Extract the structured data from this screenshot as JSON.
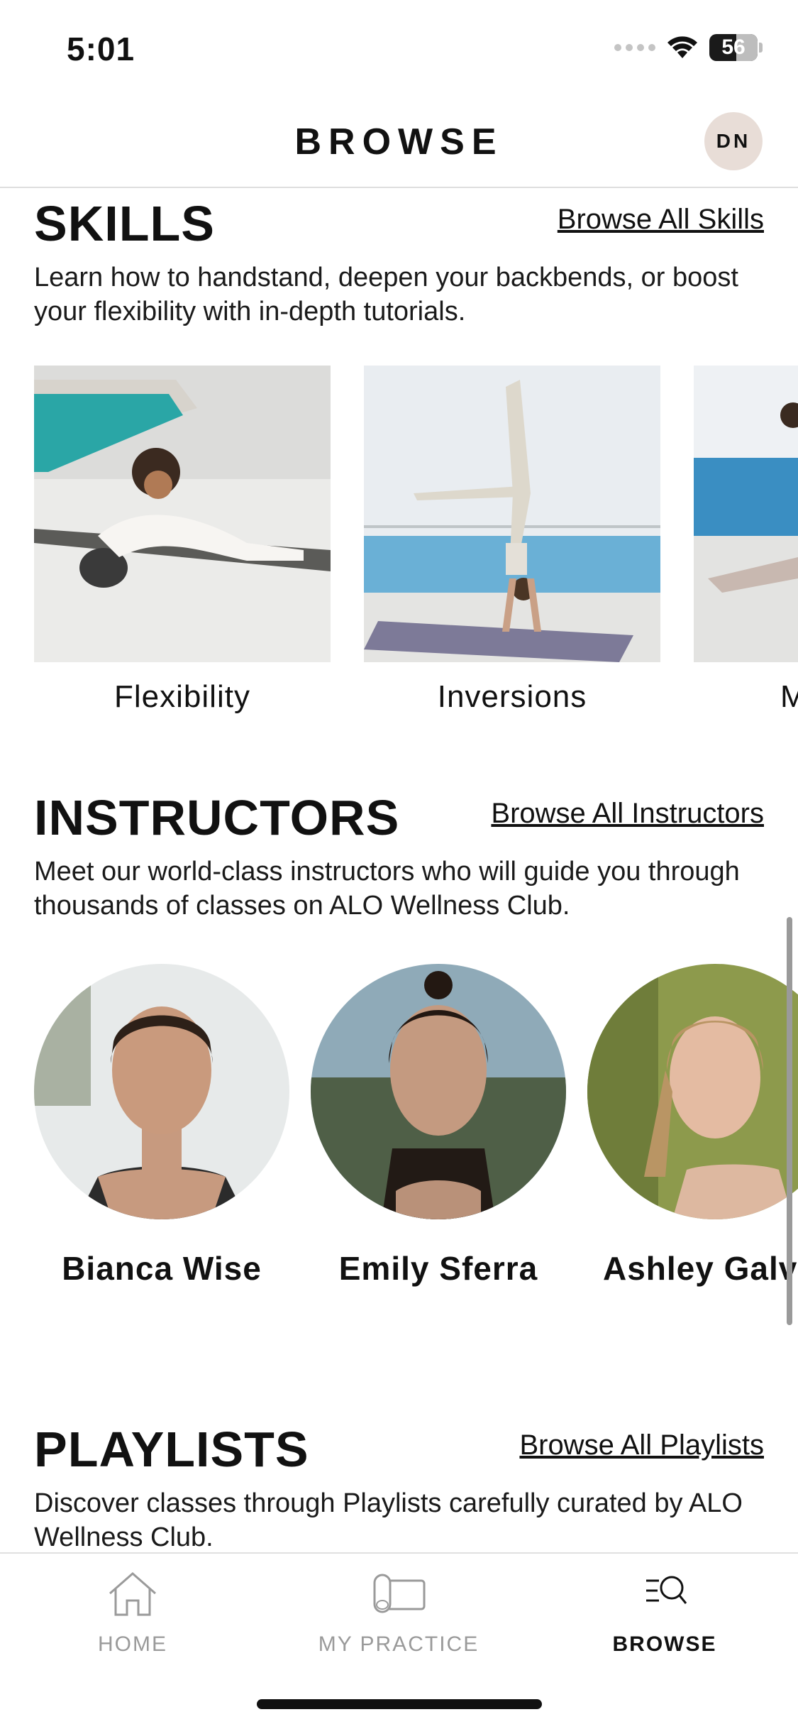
{
  "status_bar": {
    "time": "5:01",
    "battery": "56"
  },
  "header": {
    "title": "BROWSE",
    "avatar_initials": "DN"
  },
  "skills": {
    "title": "SKILLS",
    "link": "Browse All Skills",
    "description": "Learn how to handstand, deepen your backbends, or boost your flexibility with in-depth tutorials.",
    "items": [
      {
        "label": "Flexibility"
      },
      {
        "label": "Inversions"
      },
      {
        "label": "M"
      }
    ]
  },
  "instructors": {
    "title": "INSTRUCTORS",
    "link": "Browse All Instructors",
    "description": "Meet our world-class instructors who will guide you through thousands of classes on ALO Wellness Club.",
    "items": [
      {
        "name": "Bianca Wise"
      },
      {
        "name": "Emily Sferra"
      },
      {
        "name": "Ashley Galvi"
      }
    ]
  },
  "playlists": {
    "title": "PLAYLISTS",
    "link": "Browse All Playlists",
    "description": "Discover classes through Playlists carefully curated by ALO Wellness Club."
  },
  "tab_bar": {
    "tabs": [
      {
        "label": "HOME",
        "icon": "home-icon"
      },
      {
        "label": "MY PRACTICE",
        "icon": "mat-icon"
      },
      {
        "label": "BROWSE",
        "icon": "browse-search-icon"
      }
    ],
    "active": "BROWSE"
  }
}
